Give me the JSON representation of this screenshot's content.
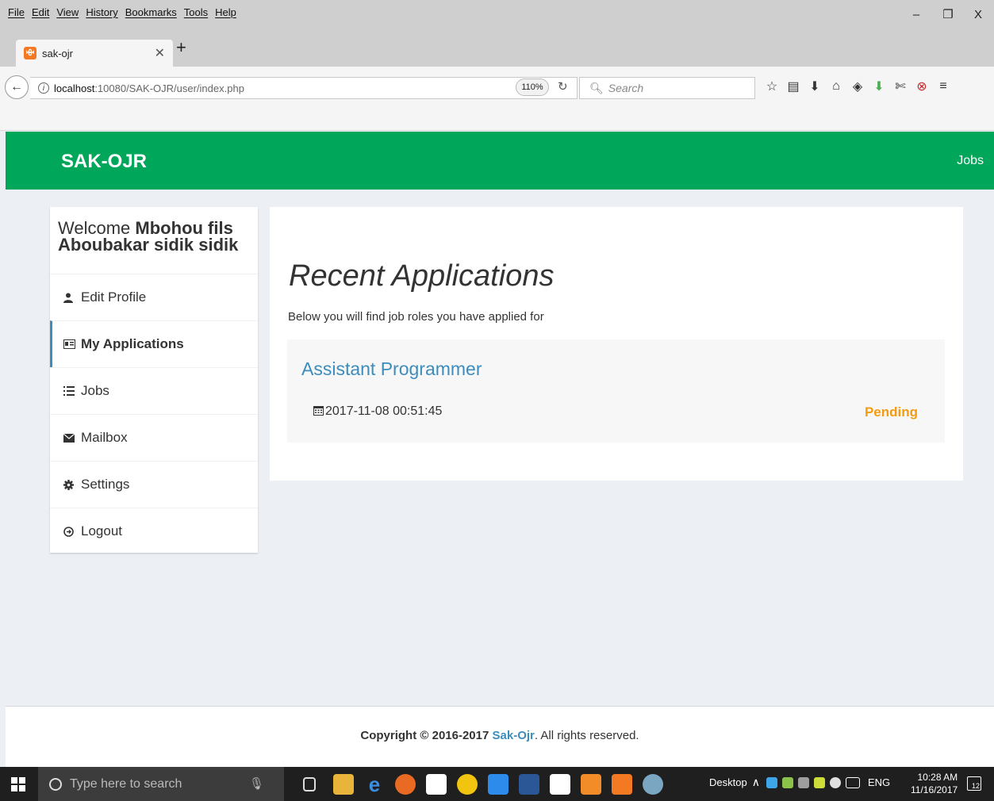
{
  "browser": {
    "menus": [
      "File",
      "Edit",
      "View",
      "History",
      "Bookmarks",
      "Tools",
      "Help"
    ],
    "tab_title": "sak-ojr",
    "url_host": "localhost",
    "url_path": ":10080/SAK-OJR/user/index.php",
    "zoom": "110%",
    "search_placeholder": "Search",
    "window_controls": {
      "minimize": "–",
      "restore": "❐",
      "close": "X"
    }
  },
  "site": {
    "brand": "SAK-OJR",
    "nav_jobs": "Jobs",
    "accent_color": "#00a65a"
  },
  "sidebar": {
    "welcome_prefix": "Welcome",
    "welcome_name": "Mbohou fils Aboubakar sidik sidik",
    "items": [
      {
        "label": "Edit Profile",
        "icon": "user-icon"
      },
      {
        "label": "My Applications",
        "icon": "id-card-icon"
      },
      {
        "label": "Jobs",
        "icon": "list-icon"
      },
      {
        "label": "Mailbox",
        "icon": "envelope-icon"
      },
      {
        "label": "Settings",
        "icon": "gear-icon"
      },
      {
        "label": "Logout",
        "icon": "logout-icon"
      }
    ],
    "active_index": 1
  },
  "main": {
    "title": "Recent Applications",
    "subtitle": "Below you will find job roles you have applied for",
    "applications": [
      {
        "title": "Assistant Programmer",
        "date": "2017-11-08 00:51:45",
        "status": "Pending",
        "status_color": "#f39c12"
      }
    ]
  },
  "footer": {
    "copyright": "Copyright © 2016-2017",
    "link": "Sak-Ojr",
    "suffix": ". All rights reserved."
  },
  "taskbar": {
    "search_placeholder": "Type here to search",
    "desktop_label": "Desktop",
    "language": "ENG",
    "time": "10:28 AM",
    "date": "11/16/2017",
    "notifications": "12"
  }
}
